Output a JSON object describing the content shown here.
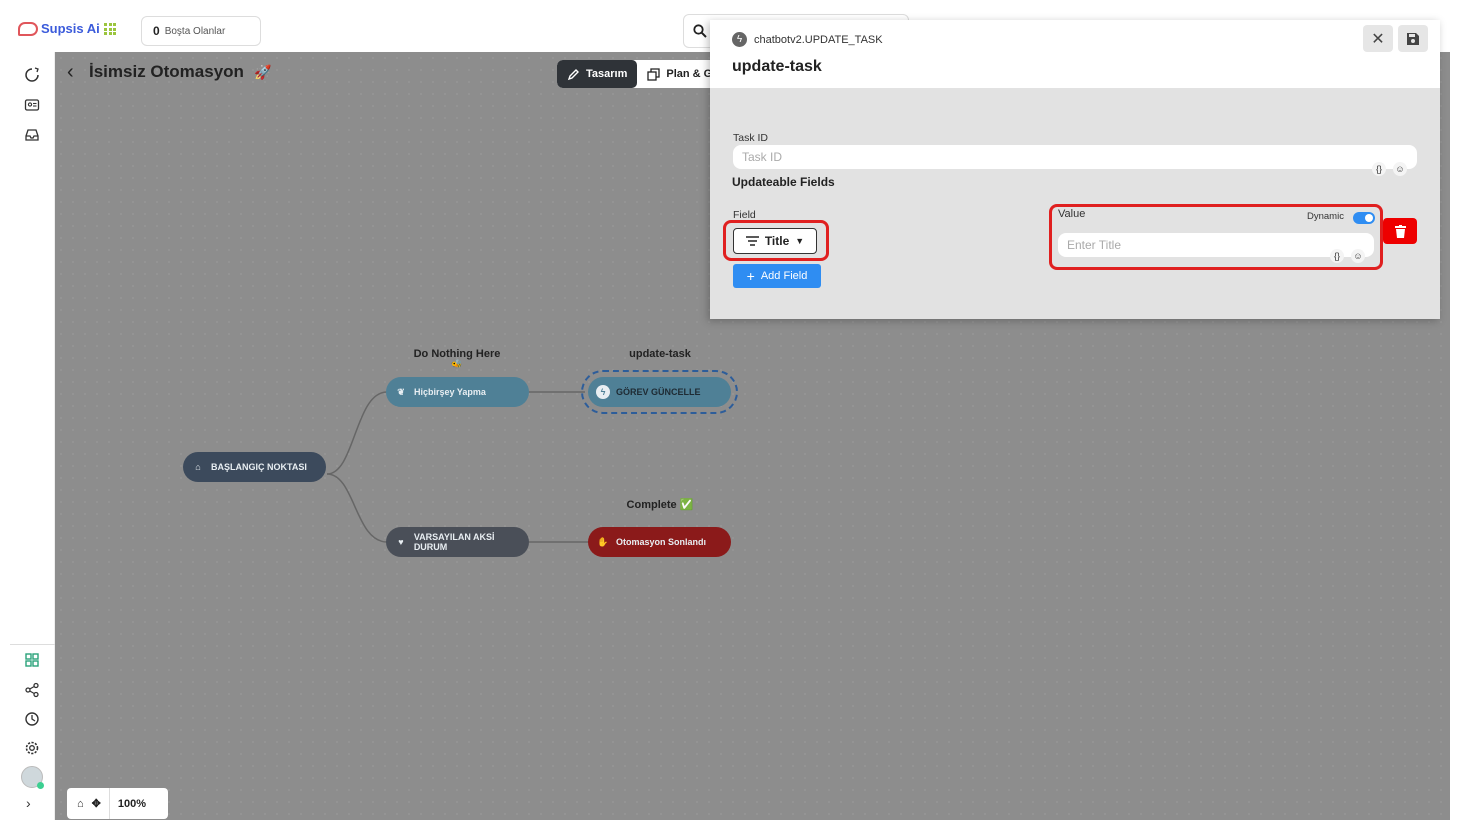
{
  "app": {
    "brand": "Supsis Ai",
    "idle_count": "0",
    "idle_label": "Boşta Olanlar"
  },
  "canvas": {
    "title": "İsimsiz Otomasyon",
    "title_emoji": "🚀",
    "tabs": [
      {
        "label": "Tasarım",
        "active": true
      },
      {
        "label": "Plan & G",
        "active": false
      }
    ],
    "zoom": "100%"
  },
  "flow": {
    "nodes": {
      "start": "BAŞLANGIÇ NOKTASI",
      "noop": "Hiçbirşey Yapma",
      "update": "GÖREV GÜNCELLE",
      "default": "VARSAYILAN AKSİ DURUM",
      "end": "Otomasyon Sonlandı"
    },
    "labels": {
      "noop": "Do Nothing Here",
      "noop_emoji": "🐝",
      "update": "update-task",
      "end": "Complete",
      "end_emoji": "✅"
    }
  },
  "panel": {
    "subtitle": "chatbotv2.UPDATE_TASK",
    "title": "update-task",
    "task_id_label": "Task ID",
    "task_id_placeholder": "Task ID",
    "section_title": "Updateable Fields",
    "field_label": "Field",
    "field_value": "Title",
    "add_field": "Add Field",
    "value_label": "Value",
    "dynamic_label": "Dynamic",
    "dynamic_enabled": true,
    "value_placeholder": "Enter Title"
  },
  "colors": {
    "accent": "#2f8df2",
    "danger": "#e00000",
    "highlight": "#e02020",
    "canvas": "#8d8d8d"
  }
}
